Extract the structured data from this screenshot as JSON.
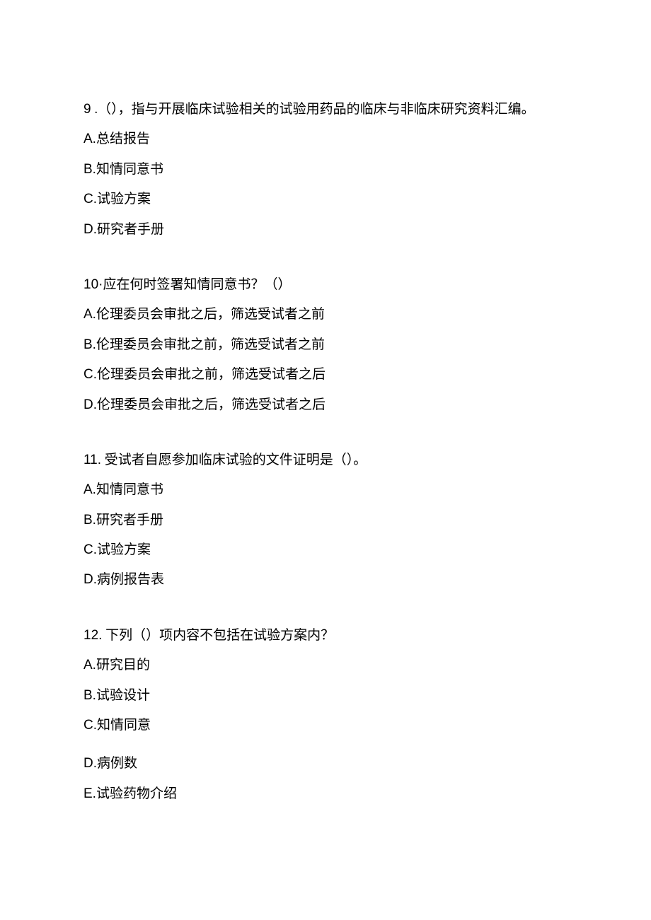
{
  "questions": [
    {
      "number": "9",
      "sep": " .",
      "stem": "（），指与开展临床试验相关的试验用药品的临床与非临床研究资料汇编。",
      "options": [
        {
          "letter": "A.",
          "text": "总结报告"
        },
        {
          "letter": "B.",
          "text": "知情同意书"
        },
        {
          "letter": "C.",
          "text": "试验方案"
        },
        {
          "letter": "D.",
          "text": "研究者手册"
        }
      ]
    },
    {
      "number": "10·",
      "sep": "",
      "stem": "应在何时签署知情同意书？（）",
      "options": [
        {
          "letter": "A.",
          "text": "伦理委员会审批之后，筛选受试者之前"
        },
        {
          "letter": "B.",
          "text": "伦理委员会审批之前，筛选受试者之前"
        },
        {
          "letter": "C.",
          "text": "伦理委员会审批之前，筛选受试者之后"
        },
        {
          "letter": "D.",
          "text": "伦理委员会审批之后，筛选受试者之后"
        }
      ]
    },
    {
      "number": "11.",
      "sep": " ",
      "stem": "受试者自愿参加临床试验的文件证明是（）。",
      "options": [
        {
          "letter": "A.",
          "text": "知情同意书"
        },
        {
          "letter": "B.",
          "text": "研究者手册"
        },
        {
          "letter": "C.",
          "text": "试验方案"
        },
        {
          "letter": "D.",
          "text": "病例报告表"
        }
      ]
    },
    {
      "number": "12.",
      "sep": " ",
      "stem": "下列（）项内容不包括在试验方案内？",
      "options": [
        {
          "letter": "A.",
          "text": "研究目的"
        },
        {
          "letter": "B.",
          "text": "试验设计"
        },
        {
          "letter": "C.",
          "text": "知情同意"
        },
        {
          "letter": "D.",
          "text": "病例数"
        },
        {
          "letter": "E.",
          "text": "试验药物介绍"
        }
      ]
    }
  ]
}
